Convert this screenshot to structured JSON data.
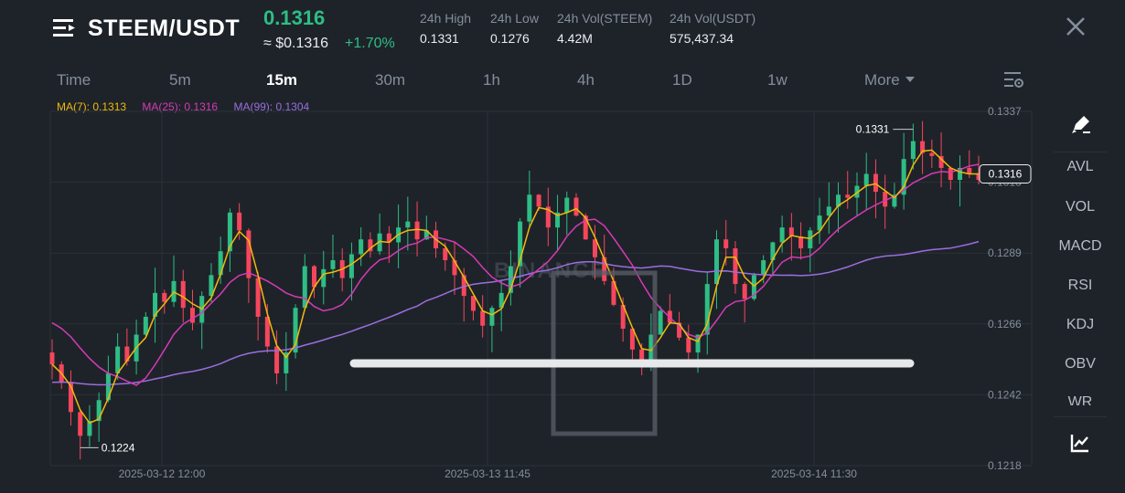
{
  "header": {
    "pair": "STEEM/USDT",
    "price": "0.1316",
    "usd_price": "≈ $0.1316",
    "change": "+1.70%",
    "stats": [
      {
        "label": "24h High",
        "value": "0.1331"
      },
      {
        "label": "24h Low",
        "value": "0.1276"
      },
      {
        "label": "24h Vol(STEEM)",
        "value": "4.42M"
      },
      {
        "label": "24h Vol(USDT)",
        "value": "575,437.34"
      }
    ]
  },
  "tabs": {
    "items": [
      "Time",
      "5m",
      "15m",
      "30m",
      "1h",
      "4h",
      "1D",
      "1w",
      "More"
    ],
    "active": "15m"
  },
  "ma_legend": {
    "ma7": "MA(7): 0.1313",
    "ma25": "MA(25): 0.1316",
    "ma99": "MA(99): 0.1304"
  },
  "sidebar": {
    "items": [
      "AVL",
      "VOL",
      "MACD",
      "RSI",
      "KDJ",
      "OBV",
      "WR"
    ]
  },
  "colors": {
    "background": "#1e2329",
    "up": "#2ebd85",
    "down": "#f6465d",
    "ma7": "#f0b90b",
    "ma25": "#d63ab5",
    "ma99": "#9b6ee0",
    "grid": "#2b3139",
    "muted": "#848e9c"
  },
  "icons": {
    "menu": "menu-icon",
    "close": "close-icon",
    "settings": "chart-settings-icon",
    "draw": "pencil-icon",
    "indicator": "chart-line-icon"
  },
  "chart_data": {
    "type": "candlestick",
    "y_ticks": [
      "0.1337",
      "0.1313",
      "0.1289",
      "0.1266",
      "0.1242",
      "0.1218"
    ],
    "x_ticks": [
      "2025-03-12 12:00",
      "2025-03-13 11:45",
      "2025-03-14 11:30"
    ],
    "ylim": [
      0.1218,
      0.1337
    ],
    "high_label": "0.1331",
    "low_label": "0.1224",
    "last_price": "0.1316",
    "grid": true,
    "watermark": "BINANCE",
    "close_series": [
      0.1252,
      0.1246,
      0.1236,
      0.1228,
      0.1233,
      0.124,
      0.1249,
      0.1258,
      0.1253,
      0.1262,
      0.1268,
      0.1276,
      0.1273,
      0.128,
      0.1271,
      0.1266,
      0.1275,
      0.1282,
      0.129,
      0.1303,
      0.1297,
      0.1281,
      0.1268,
      0.1258,
      0.1249,
      0.1256,
      0.1271,
      0.1285,
      0.1278,
      0.1284,
      0.1287,
      0.1281,
      0.1289,
      0.1294,
      0.129,
      0.1296,
      0.1293,
      0.1298,
      0.13,
      0.1294,
      0.1297,
      0.1291,
      0.1287,
      0.1282,
      0.1275,
      0.127,
      0.1265,
      0.1271,
      0.1276,
      0.1285,
      0.13,
      0.1309,
      0.1305,
      0.1298,
      0.1303,
      0.1308,
      0.1302,
      0.1294,
      0.1288,
      0.128,
      0.1272,
      0.1264,
      0.1257,
      0.1251,
      0.1262,
      0.127,
      0.1266,
      0.1261,
      0.1256,
      0.1262,
      0.1279,
      0.1294,
      0.1291,
      0.1279,
      0.1274,
      0.1282,
      0.1287,
      0.1293,
      0.1298,
      0.1295,
      0.1291,
      0.1297,
      0.1302,
      0.1305,
      0.1309,
      0.1308,
      0.1312,
      0.1316,
      0.131,
      0.1305,
      0.1309,
      0.1321,
      0.1327,
      0.1323,
      0.1322,
      0.1318,
      0.1314,
      0.1318,
      0.1316,
      0.1314
    ]
  }
}
